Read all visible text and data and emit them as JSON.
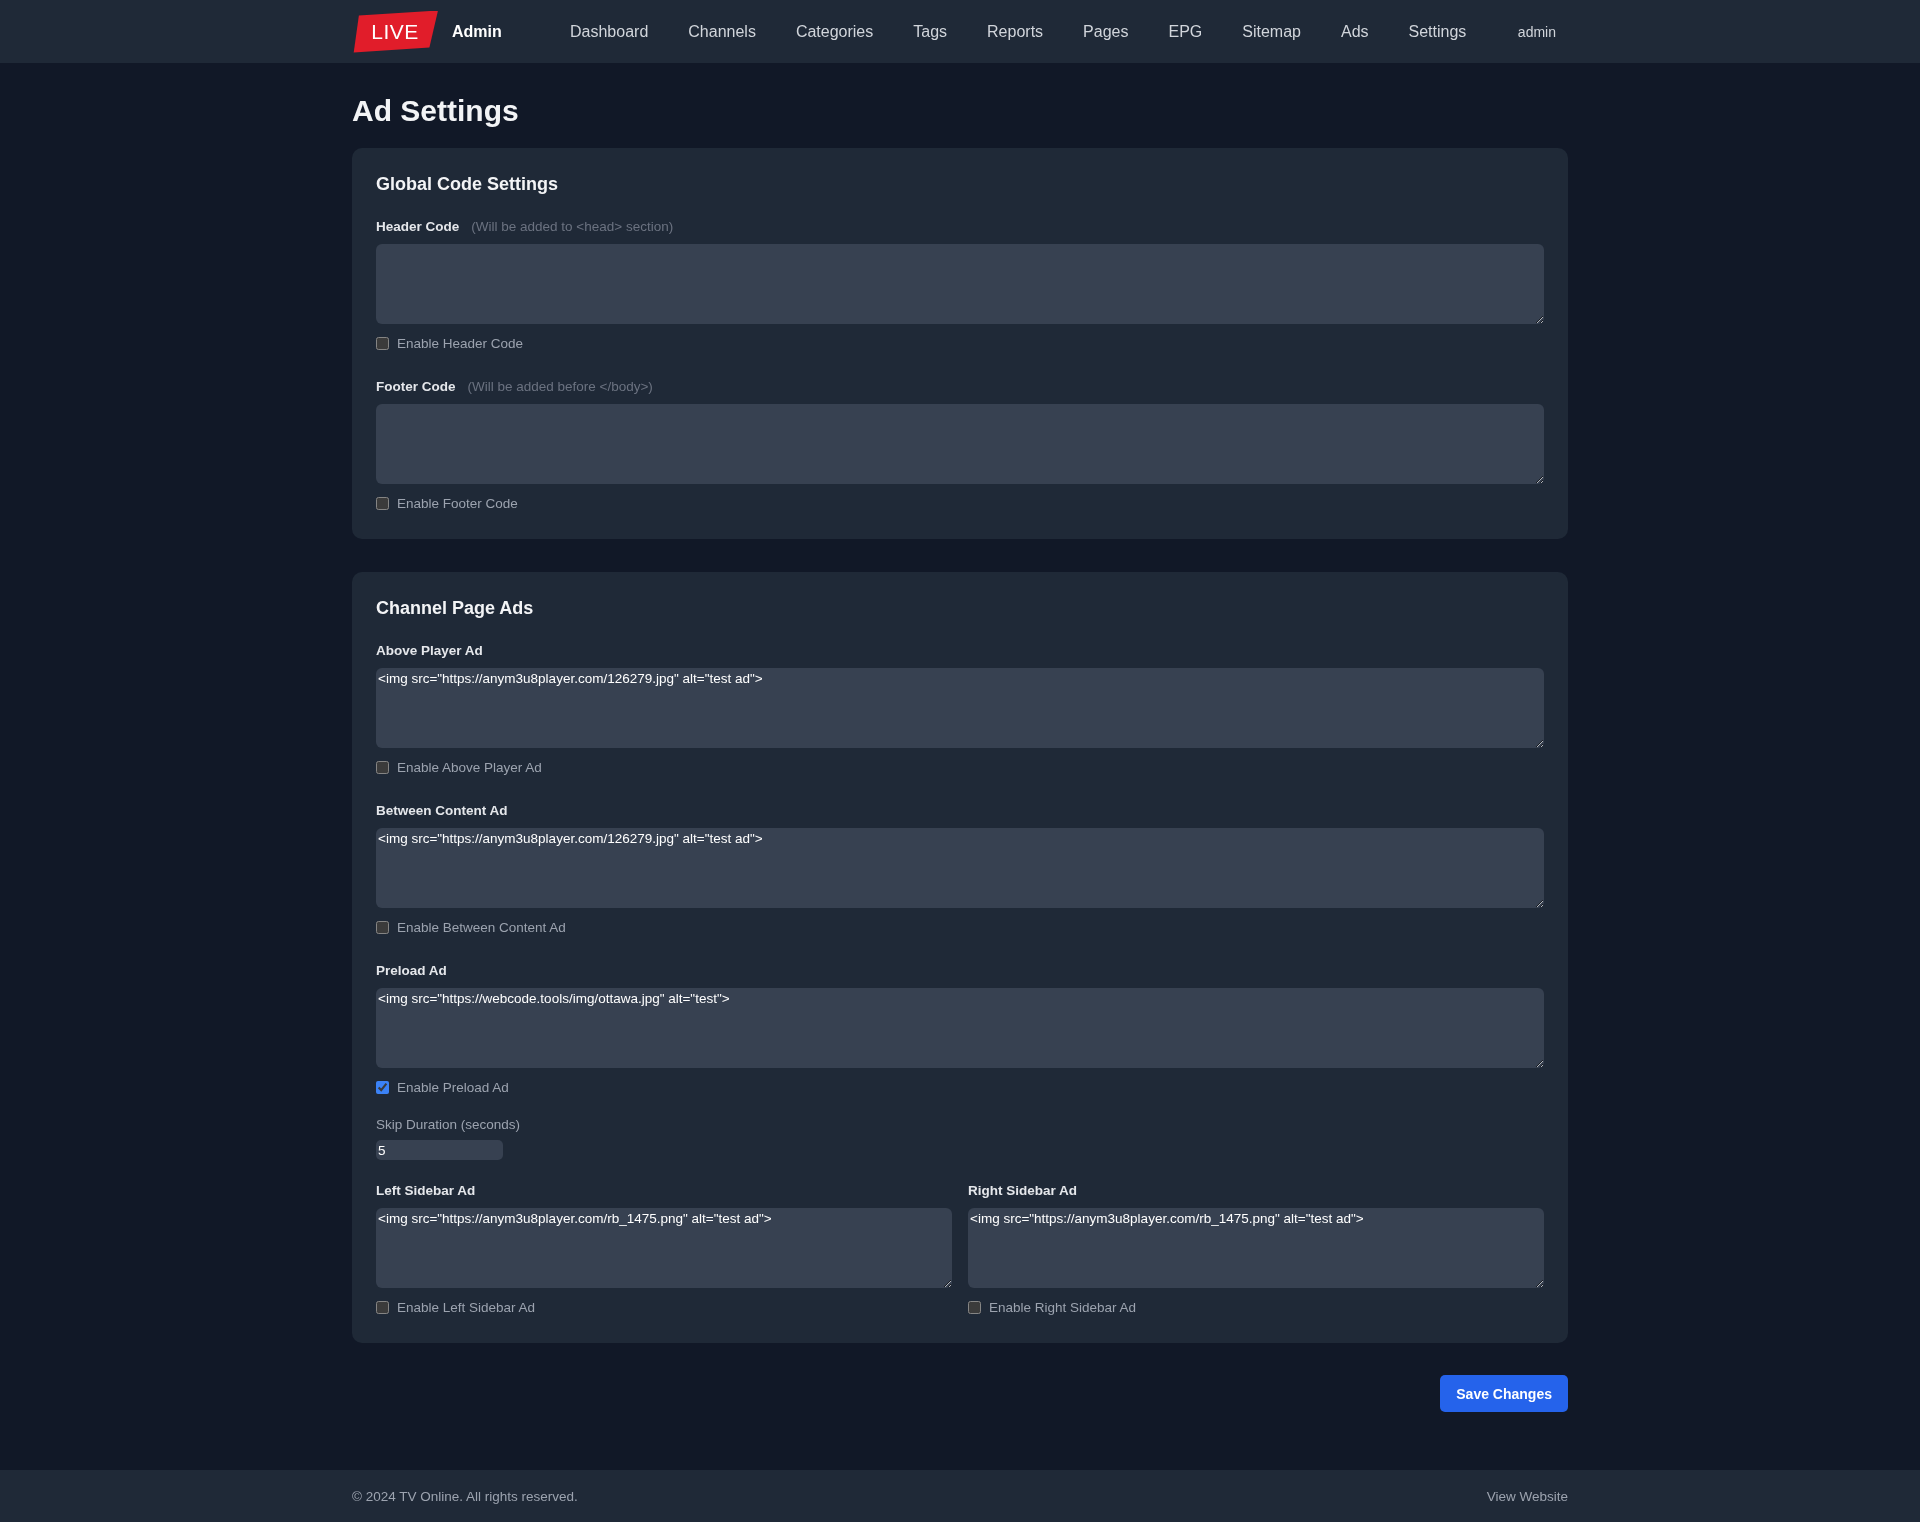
{
  "nav": {
    "logo": "LIVE",
    "brand": "Admin",
    "links": [
      {
        "label": "Dashboard",
        "selected": false
      },
      {
        "label": "Channels",
        "selected": false
      },
      {
        "label": "Categories",
        "selected": false
      },
      {
        "label": "Tags",
        "selected": false
      },
      {
        "label": "Reports",
        "selected": false
      },
      {
        "label": "Pages",
        "selected": false
      },
      {
        "label": "EPG",
        "selected": false
      },
      {
        "label": "Sitemap",
        "selected": false
      },
      {
        "label": "Ads",
        "selected": false
      },
      {
        "label": "Settings",
        "selected": false
      }
    ],
    "user": "admin"
  },
  "page_title": "Ad Settings",
  "sections": [
    {
      "title": "Global Code Settings",
      "fields": [
        {
          "kind": "code",
          "label": "Header Code",
          "hint": "(Will be added to <head> section)",
          "toggle": {
            "label": "Enable Header Code",
            "checked": false
          }
        },
        {
          "kind": "code",
          "label": "Footer Code",
          "hint": "(Will be added before </body>)",
          "toggle": {
            "label": "Enable Footer Code",
            "checked": false
          }
        }
      ]
    },
    {
      "title": "Channel Page Ads",
      "fields": [
        {
          "kind": "code",
          "label": "Above Player Ad",
          "value": "<img src=\"https://anym3u8player.com/126279.jpg\" alt=\"test ad\">",
          "toggle": {
            "label": "Enable Above Player Ad",
            "checked": false
          }
        },
        {
          "kind": "code",
          "label": "Between Content Ad",
          "value": "<img src=\"https://anym3u8player.com/126279.jpg\" alt=\"test ad\">",
          "toggle": {
            "label": "Enable Between Content Ad",
            "checked": false
          }
        },
        {
          "kind": "code",
          "label": "Preload Ad",
          "value": "<img src=\"https://webcode.tools/img/ottawa.jpg\" alt=\"test\">",
          "toggle": {
            "label": "Enable Preload Ad",
            "checked": true
          }
        },
        {
          "kind": "number",
          "label": "Skip Duration (seconds)",
          "value": "5"
        },
        {
          "kind": "pair",
          "fields": [
            {
              "kind": "code",
              "label": "Left Sidebar Ad",
              "value": "<img src=\"https://anym3u8player.com/rb_1475.png\" alt=\"test ad\">",
              "toggle": {
                "label": "Enable Left Sidebar Ad",
                "checked": false
              }
            },
            {
              "kind": "code",
              "label": "Right Sidebar Ad",
              "value": "<img src=\"https://anym3u8player.com/rb_1475.png\" alt=\"test ad\">",
              "toggle": {
                "label": "Enable Right Sidebar Ad",
                "checked": false
              }
            }
          ]
        }
      ]
    }
  ],
  "save_button": "Save Changes",
  "footer": {
    "copyright": "© 2024 TV Online. All rights reserved.",
    "link": "View Website"
  }
}
